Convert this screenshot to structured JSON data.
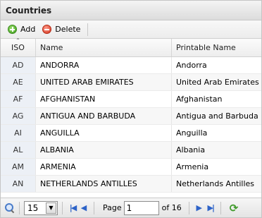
{
  "title": "Countries",
  "toolbar": {
    "add_label": "Add",
    "delete_label": "Delete"
  },
  "columns": {
    "iso": "ISO",
    "name": "Name",
    "printable": "Printable Name"
  },
  "rows": [
    {
      "iso": "AD",
      "name": "ANDORRA",
      "printable": "Andorra"
    },
    {
      "iso": "AE",
      "name": "UNITED ARAB EMIRATES",
      "printable": "United Arab Emirates"
    },
    {
      "iso": "AF",
      "name": "AFGHANISTAN",
      "printable": "Afghanistan"
    },
    {
      "iso": "AG",
      "name": "ANTIGUA AND BARBUDA",
      "printable": "Antigua and Barbuda"
    },
    {
      "iso": "AI",
      "name": "ANGUILLA",
      "printable": "Anguilla"
    },
    {
      "iso": "AL",
      "name": "ALBANIA",
      "printable": "Albania"
    },
    {
      "iso": "AM",
      "name": "ARMENIA",
      "printable": "Armenia"
    },
    {
      "iso": "AN",
      "name": "NETHERLANDS ANTILLES",
      "printable": "Netherlands Antilles"
    }
  ],
  "pager": {
    "page_size": "15",
    "page_label": "Page",
    "page_value": "1",
    "of_label": "of 16"
  },
  "icons": {
    "add": "plus-circle-icon",
    "delete": "minus-circle-icon",
    "search": "search-icon",
    "first": "first-page-icon",
    "prev": "prev-page-icon",
    "next": "next-page-icon",
    "last": "last-page-icon",
    "refresh": "refresh-icon"
  },
  "colors": {
    "accent": "#2d63c8",
    "add_green": "#3c9a1c",
    "delete_red": "#d1321b"
  }
}
